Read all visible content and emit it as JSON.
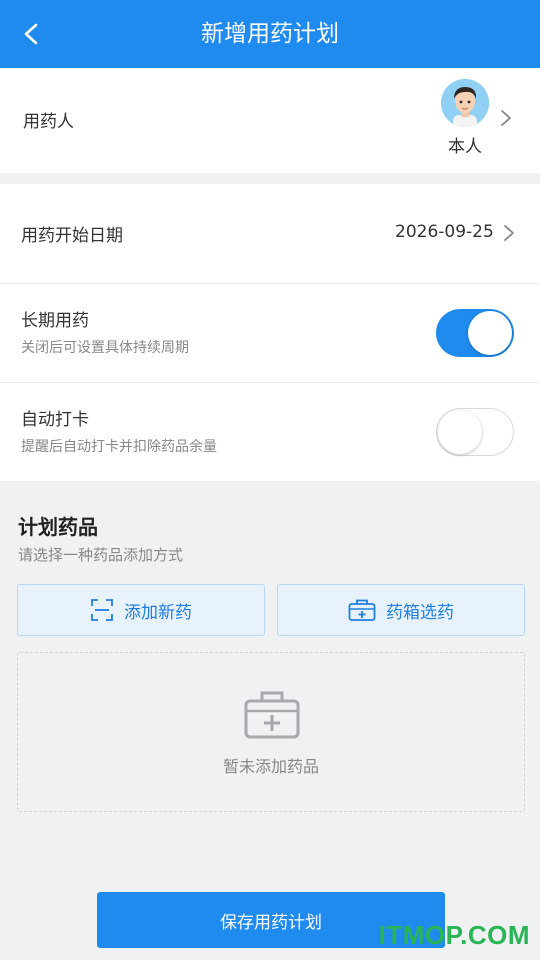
{
  "header": {
    "title": "新增用药计划"
  },
  "user_row": {
    "label": "用药人",
    "name": "本人"
  },
  "start_date": {
    "label": "用药开始日期",
    "value": "2026-09-25"
  },
  "long_term": {
    "label": "长期用药",
    "sub": "关闭后可设置具体持续周期",
    "enabled": true
  },
  "auto_checkin": {
    "label": "自动打卡",
    "sub": "提醒后自动打卡并扣除药品余量",
    "enabled": false
  },
  "plan": {
    "title": "计划药品",
    "sub": "请选择一种药品添加方式",
    "add_new_label": "添加新药",
    "from_box_label": "药箱选药",
    "empty_text": "暂未添加药品"
  },
  "save_label": "保存用药计划",
  "watermark": "ITMOP.COM",
  "colors": {
    "primary": "#1f8bee",
    "watermark": "#29b554"
  }
}
